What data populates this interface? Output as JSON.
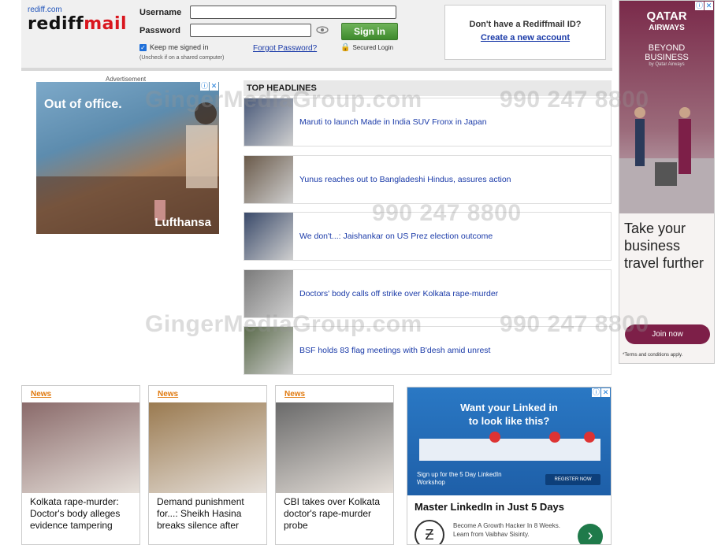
{
  "login": {
    "brand_small": "rediff.com",
    "brand_logo_a": "rediff",
    "brand_logo_b": "mail",
    "username_label": "Username",
    "password_label": "Password",
    "username_value": "",
    "password_value": "",
    "signin_label": "Sign in",
    "keep_signed_in": "Keep me signed in",
    "note": "(Uncheck if on a shared computer)",
    "forgot": "Forgot Password?",
    "secure": "Secured Login",
    "no_id": "Don't have a Rediffmail ID?",
    "create": "Create a new account"
  },
  "left_ad": {
    "label": "Advertisement",
    "headline": "Out of office.",
    "brand": "Lufthansa"
  },
  "right_ad": {
    "logo_line1": "QATAR",
    "logo_line2": "AIRWAYS",
    "sub1": "BEYOND",
    "sub2": "BUSINESS",
    "sub3": "by Qatar Airways",
    "tagline": "Take your business travel further",
    "button": "Join now",
    "terms": "*Terms and conditions apply."
  },
  "headlines": {
    "title": "TOP HEADLINES",
    "items": [
      {
        "text": "Maruti to launch Made in India SUV Fronx in Japan",
        "color": "#4a5a7a"
      },
      {
        "text": "Yunus reaches out to Bangladeshi Hindus, assures action",
        "color": "#6a5a4a"
      },
      {
        "text": "We don't...: Jaishankar on US Prez election outcome",
        "color": "#3a4a6a"
      },
      {
        "text": "Doctors' body calls off strike over Kolkata rape-murder",
        "color": "#7a7a7a"
      },
      {
        "text": "BSF holds 83 flag meetings with B'desh amid unrest",
        "color": "#5a6a4a"
      }
    ]
  },
  "news_cards": [
    {
      "tag": "News",
      "text": "Kolkata rape-murder: Doctor's body alleges evidence tampering",
      "color": "#8a6a6a"
    },
    {
      "tag": "News",
      "text": "Demand punishment for...: Sheikh Hasina breaks silence after",
      "color": "#9a7a50"
    },
    {
      "tag": "News",
      "text": "CBI takes over Kolkata doctor's rape-murder probe",
      "color": "#6a6a6a"
    }
  ],
  "linkedin_ad": {
    "line1": "Want your Linked in",
    "line2": "to look like this?",
    "signup": "Sign up for the 5 Day LinkedIn Workshop",
    "register": "REGISTER NOW",
    "master": "Master LinkedIn in Just 5 Days",
    "desc": "Become A Growth Hacker In 8 Weeks. Learn from Vaibhav Sisinty."
  },
  "watermark": {
    "site": "GingerMediaGroup.com",
    "phone": "990 247 8800"
  }
}
